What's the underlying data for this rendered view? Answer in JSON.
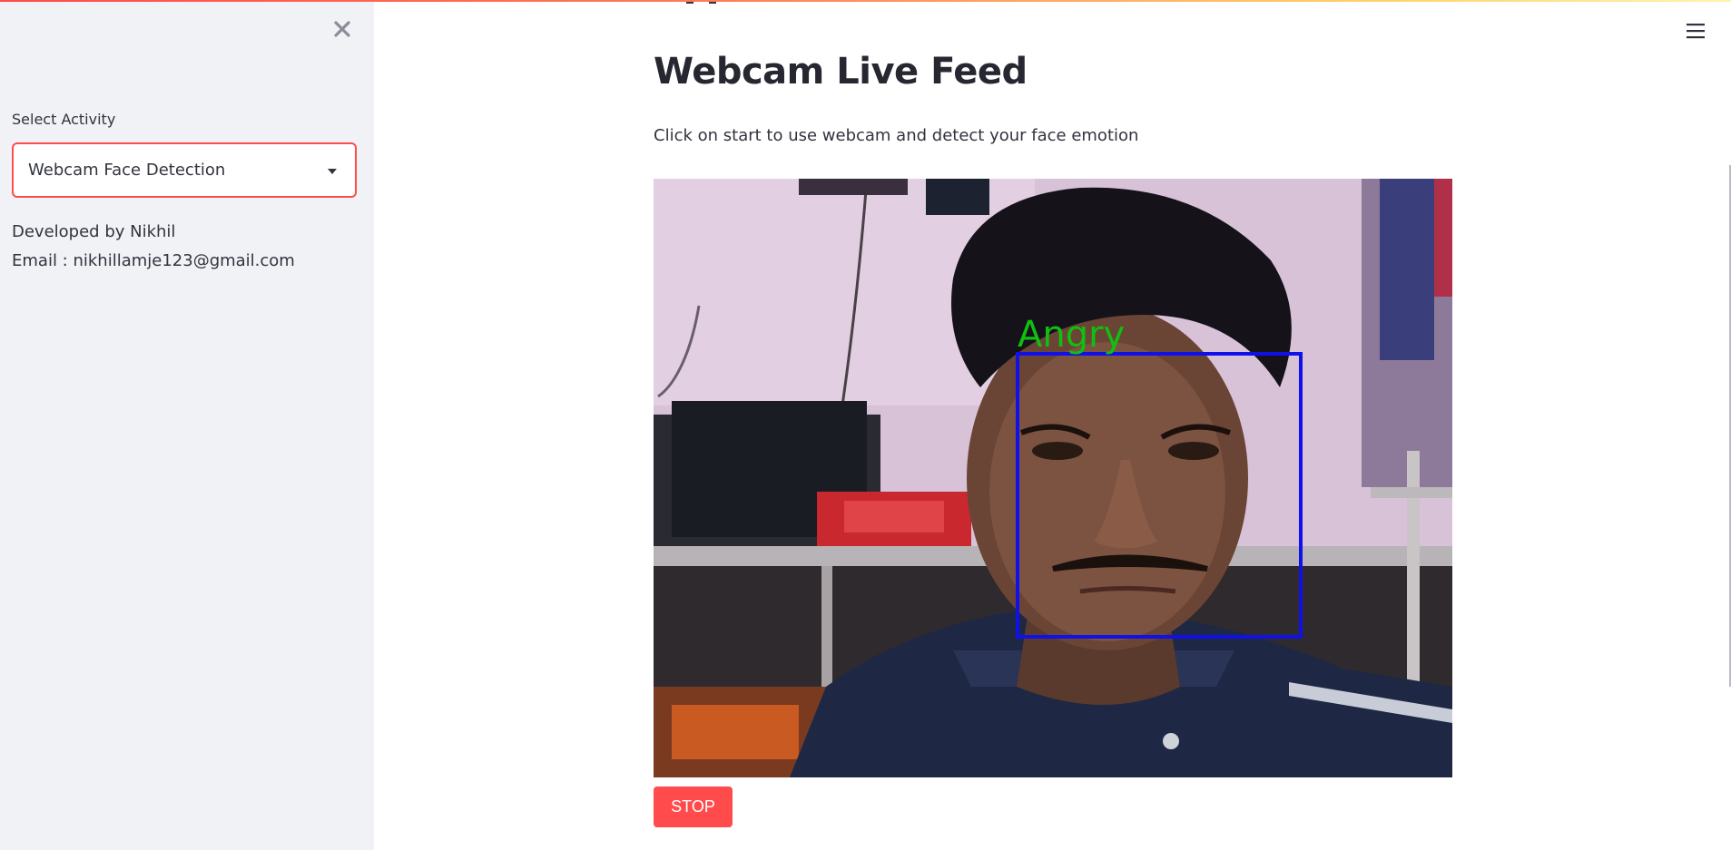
{
  "sidebar": {
    "close_icon": "close-icon",
    "activity_label": "Select Activity",
    "activity_selected": "Webcam Face Detection",
    "developer_text": "Developed by Nikhil",
    "email_text": "Email : nikhillamje123@gmail.com"
  },
  "header": {
    "menu_icon": "hamburger-menu-icon"
  },
  "main": {
    "title": "Webcam Live Feed",
    "description": "Click on start to use webcam and detect your face emotion",
    "detection_label": "Angry",
    "stop_label": "STOP"
  },
  "colors": {
    "accent": "#ff4b4b",
    "sidebar_bg": "#f0f2f6",
    "text": "#31333f",
    "detection_box": "#1010e8",
    "detection_text": "#10c010"
  }
}
